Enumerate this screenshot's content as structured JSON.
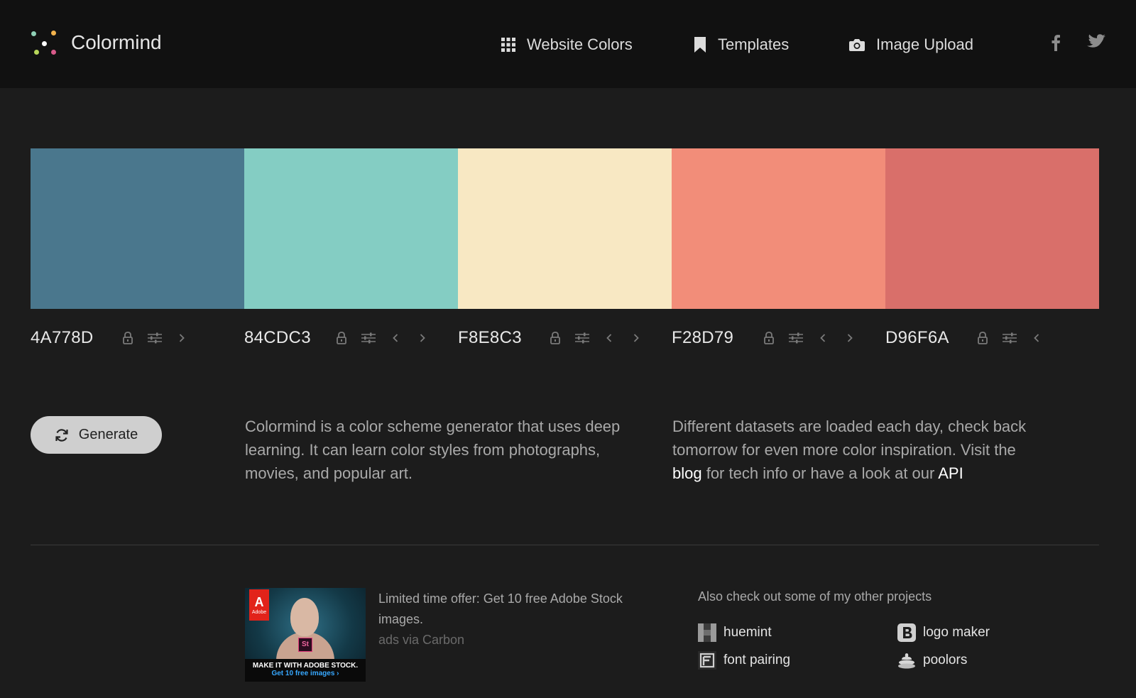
{
  "brand": {
    "name": "Colormind"
  },
  "logo": {
    "dot_colors": [
      "#8fd0b6",
      "#ffffff",
      "#f2b24c",
      "#d95a8a",
      "#6b8de0",
      "#b7d65a"
    ]
  },
  "nav": {
    "website_colors": "Website Colors",
    "templates": "Templates",
    "image_upload": "Image Upload"
  },
  "palette": {
    "swatches": [
      {
        "hex": "4A778D",
        "color": "#4A778D"
      },
      {
        "hex": "84CDC3",
        "color": "#84CDC3"
      },
      {
        "hex": "F8E8C3",
        "color": "#F8E8C3"
      },
      {
        "hex": "F28D79",
        "color": "#F28D79"
      },
      {
        "hex": "D96F6A",
        "color": "#D96F6A"
      }
    ]
  },
  "generate": {
    "label": "Generate"
  },
  "about": {
    "text": "Colormind is a color scheme generator that uses deep learning. It can learn color styles from photographs, movies, and popular art."
  },
  "datasets": {
    "text_1": "Different datasets are loaded each day, check back tomorrow for even more color inspiration. Visit the ",
    "blog_link": "blog",
    "text_2": " for tech info or have a look at our ",
    "api_link": "API"
  },
  "ad": {
    "brand_letter": "A",
    "brand_name": "Adobe",
    "product_code": "St",
    "banner_line1": "MAKE IT WITH ADOBE STOCK.",
    "banner_line2": "Get 10 free images ›",
    "offer": "Limited time offer: Get 10 free Adobe Stock images.",
    "via": "ads via Carbon"
  },
  "projects": {
    "title": "Also check out some of my other projects",
    "items": [
      {
        "label": "huemint"
      },
      {
        "label": "logo maker"
      },
      {
        "label": "font pairing"
      },
      {
        "label": "poolors"
      }
    ]
  }
}
